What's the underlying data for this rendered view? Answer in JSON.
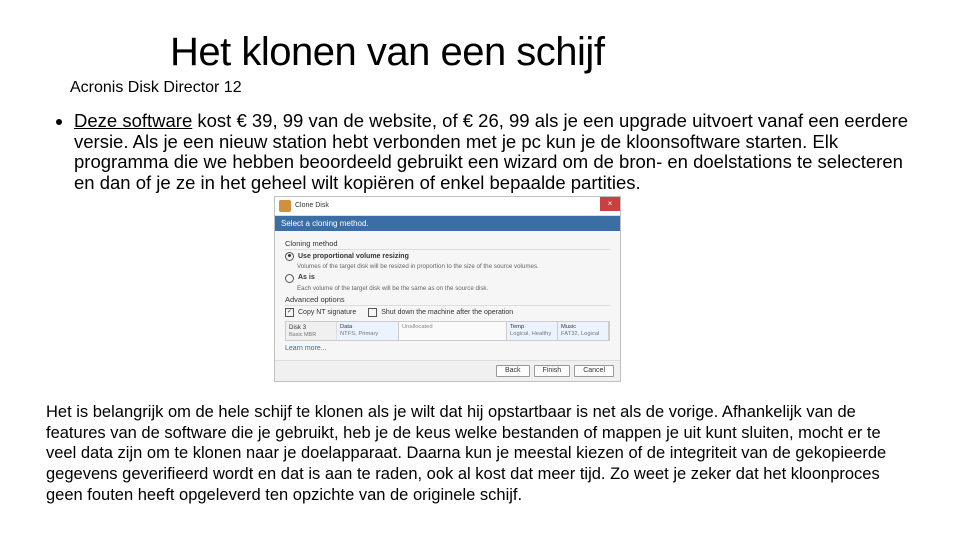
{
  "title": "Het klonen van een schijf",
  "subtitle": "Acronis Disk Director 12",
  "bullet": {
    "underlined": "Deze software",
    "rest": " kost € 39, 99 van de website, of € 26, 99 als je een upgrade uitvoert vanaf een eerdere versie. Als je een nieuw station hebt verbonden met je pc kun je de kloonsoftware starten. Elk programma die we hebben beoordeeld gebruikt een wizard om de bron- en doelstations te selecteren en dan of je ze in het geheel wilt kopiëren of enkel bepaalde partities."
  },
  "clone_window": {
    "window_title": "Clone Disk",
    "close": "×",
    "header": "Select a cloning method.",
    "method_label": "Cloning method",
    "radio1": {
      "label": "Use proportional volume resizing",
      "desc": "Volumes of the target disk will be resized in proportion to the size of the source volumes."
    },
    "radio2": {
      "label": "As is",
      "desc": "Each volume of the target disk will be the same as on the source disk."
    },
    "advanced_label": "Advanced options",
    "check1": "Copy NT signature",
    "check2": "Shut down the machine after the operation",
    "disk1": {
      "label": "Disk 3",
      "sub": "Basic MBR",
      "part_data": "Data",
      "part_data_sub": "NTFS, Primary",
      "un": "Unallocated",
      "temp": "Temp",
      "temp_sub": "Logical, Healthy",
      "music": "Music",
      "music_sub": "FAT32, Logical"
    },
    "learn": "Learn more...",
    "btn_back": "Back",
    "btn_finish": "Finish",
    "btn_cancel": "Cancel"
  },
  "footer": "Het is belangrijk om de hele schijf te klonen als je wilt dat hij opstartbaar is net als de vorige. Afhankelijk van de features van de software die je gebruikt, heb je de keus welke bestanden of mappen je uit kunt sluiten, mocht er te veel data zijn om te klonen naar je doelapparaat. Daarna kun je meestal kiezen of de integriteit van de gekopieerde gegevens geverifieerd wordt en dat is aan te raden, ook al kost dat meer tijd. Zo weet je zeker dat het kloonproces geen fouten heeft opgeleverd ten opzichte van de originele schijf."
}
